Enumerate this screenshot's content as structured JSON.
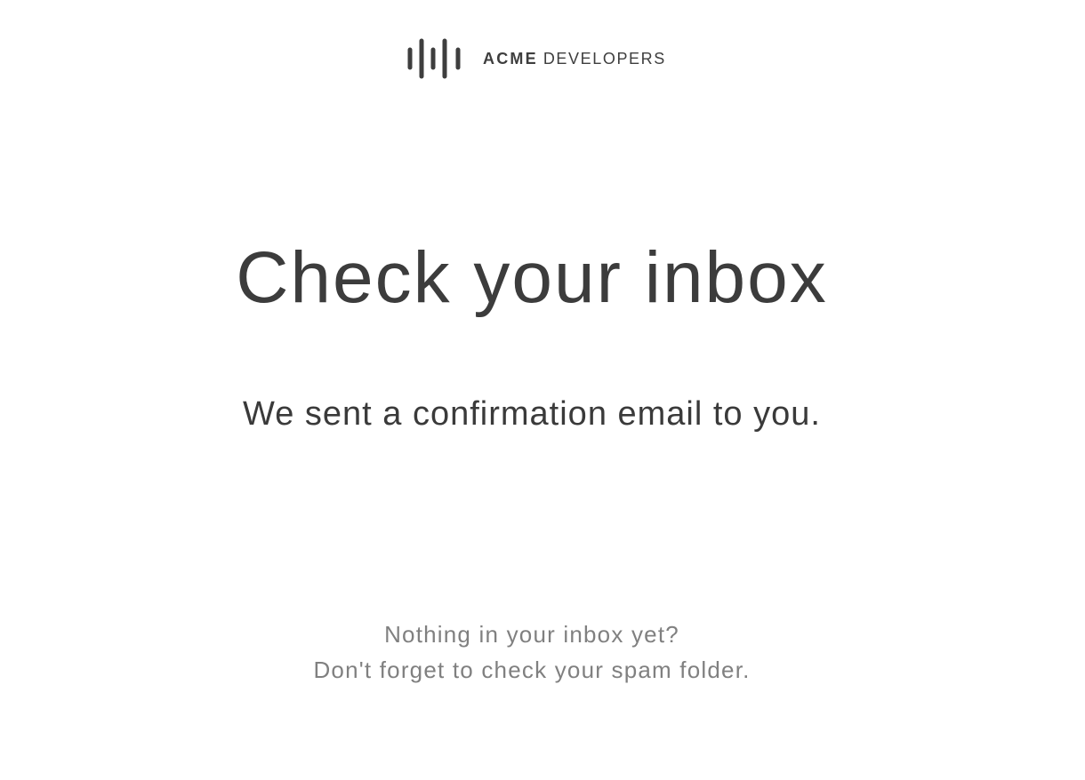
{
  "logo": {
    "brand": "ACME",
    "sub": "DEVELOPERS",
    "icon": "sound-wave-bars-icon"
  },
  "main": {
    "title": "Check your inbox",
    "message": "We sent a confirmation email to you."
  },
  "hint": {
    "line1": "Nothing in your inbox yet?",
    "line2": "Don't forget to check your spam folder."
  },
  "colors": {
    "text_dark": "#3a3a3a",
    "text_muted": "#808080",
    "background": "#ffffff"
  }
}
